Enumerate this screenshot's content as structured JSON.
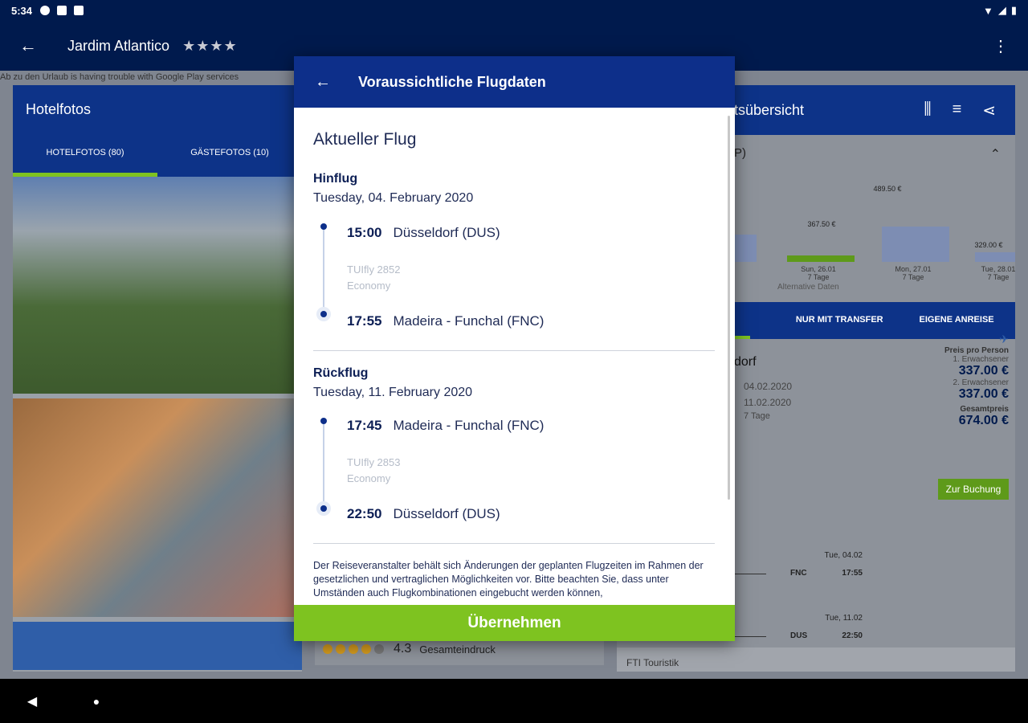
{
  "status_bar": {
    "time": "5:34"
  },
  "app_bar": {
    "title": "Jardim Atlantico",
    "stars": "★★★★"
  },
  "background": {
    "banner": "Ab zu den Urlaub is having trouble with Google Play services",
    "left_panel": {
      "title": "Hotelfotos",
      "tabs": [
        "HOTELFOTOS (80)",
        "GÄSTEFOTOS (10)"
      ]
    },
    "middle": {
      "score": "4.3",
      "label": "Gesamteindruck"
    },
    "right_panel": {
      "title": "tsübersicht",
      "subtitle": "P)",
      "prices": [
        "367.50 €",
        "489.50 €",
        "329.00 €"
      ],
      "dates": [
        [
          "Sun, 26.01",
          "7 Tage"
        ],
        [
          "Mon, 27.01",
          "7 Tage"
        ],
        [
          "Tue, 28.01",
          "7 Tage"
        ]
      ],
      "note": "Alternative Daten",
      "tabs": [
        "NUR MIT TRANSFER",
        "EIGENE ANREISE"
      ],
      "city": "dorf",
      "date_from": "04.02.2020",
      "date_to": "11.02.2020",
      "duration": "7 Tage",
      "price_label": "Preis pro Person",
      "adult1_label": "1. Erwachsener",
      "adult1_price": "337.00 €",
      "adult2_label": "2. Erwachsener",
      "adult2_price": "337.00 €",
      "total_label": "Gesamtpreis",
      "total_price": "674.00 €",
      "book_button": "Zur Buchung",
      "flight1": {
        "date": "Tue, 04.02",
        "airport": "FNC",
        "time": "17:55"
      },
      "flight2": {
        "date": "Tue, 11.02",
        "airport": "DUS",
        "time": "22:50"
      },
      "footer": "FTI Touristik"
    }
  },
  "dialog": {
    "title": "Voraussichtliche Flugdaten",
    "section_title": "Aktueller Flug",
    "outbound": {
      "label": "Hinflug",
      "date": "Tuesday, 04. February 2020",
      "departure_time": "15:00",
      "departure_place": "Düsseldorf (DUS)",
      "flight_no": "TUIfly 2852",
      "cabin": "Economy",
      "arrival_time": "17:55",
      "arrival_place": "Madeira - Funchal (FNC)"
    },
    "return": {
      "label": "Rückflug",
      "date": "Tuesday, 11. February 2020",
      "departure_time": "17:45",
      "departure_place": "Madeira - Funchal (FNC)",
      "flight_no": "TUIfly 2853",
      "cabin": "Economy",
      "arrival_time": "22:50",
      "arrival_place": "Düsseldorf (DUS)"
    },
    "disclaimer": "Der Reiseveranstalter behält sich Änderungen der geplanten Flugzeiten im Rahmen der gesetzlichen und vertraglichen Möglichkeiten vor. Bitte beachten Sie, dass unter Umständen auch Flugkombinationen eingebucht werden können,",
    "accept_button": "Übernehmen"
  }
}
